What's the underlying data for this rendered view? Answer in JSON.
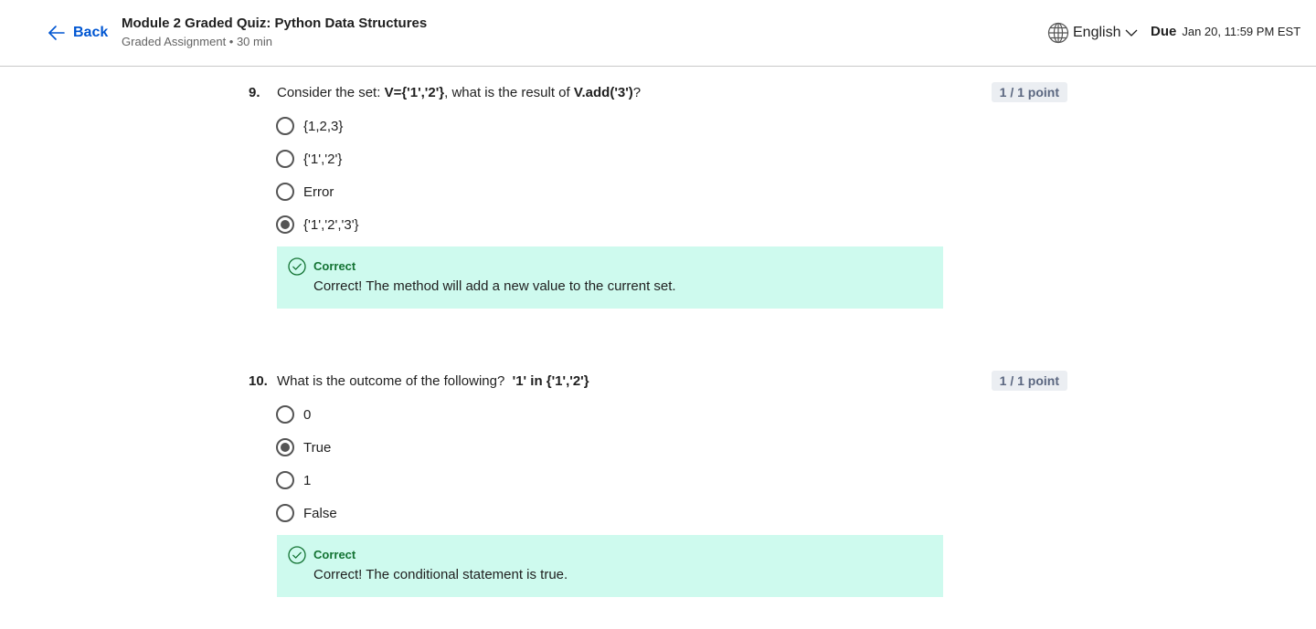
{
  "header": {
    "back_label": "Back",
    "title": "Module 2 Graded Quiz: Python Data Structures",
    "subtitle": "Graded Assignment • 30 min",
    "language": "English",
    "due_label": "Due",
    "due_date": "Jan 20, 11:59 PM EST"
  },
  "questions": [
    {
      "number": "9.",
      "text_prefix": "Consider the set: ",
      "code1": "V={'1','2'}",
      "text_middle": ", what is the result of ",
      "code2": "V.add('3')",
      "text_suffix": "?",
      "points": "1 / 1 point",
      "options": [
        "{1,2,3}",
        "{'1','2'}",
        "Error",
        "{'1','2','3'}"
      ],
      "selected_index": 3,
      "feedback_label": "Correct",
      "feedback_text": "Correct! The method will add a new value to the current set."
    },
    {
      "number": "10.",
      "text_prefix": "What is the outcome of the following?  ",
      "code1": "'1' in {'1','2'}",
      "points": "1 / 1 point",
      "options": [
        "0",
        "True",
        "1",
        "False"
      ],
      "selected_index": 1,
      "feedback_label": "Correct",
      "feedback_text": "Correct! The conditional statement is true."
    }
  ],
  "colors": {
    "accent": "#0056d2",
    "feedback_bg": "#cefaee",
    "correct_text": "#137333",
    "points_bg": "#ebeef2"
  }
}
